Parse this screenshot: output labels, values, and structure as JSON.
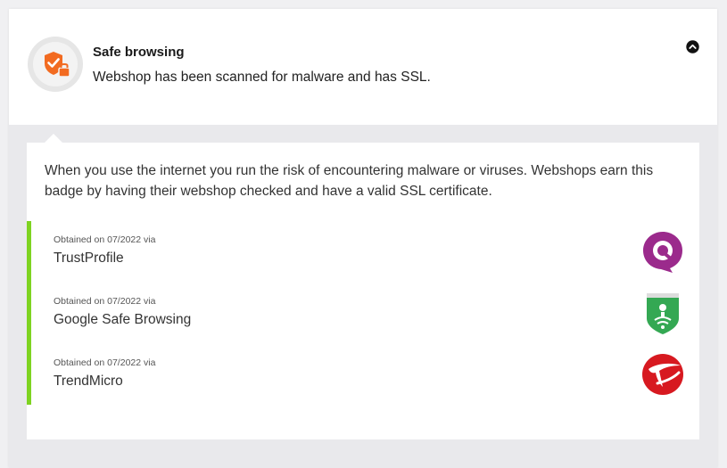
{
  "header": {
    "title": "Safe browsing",
    "subtitle": "Webshop has been scanned for malware and has SSL.",
    "badge_icon": "shield-check-lock-icon",
    "collapse_icon": "chevron-up-circle-icon"
  },
  "panel": {
    "description": "When you use the internet you run the risk of encountering malware or viruses. Webshops earn this badge by having their webshop checked and have a valid SSL certificate.",
    "sources": [
      {
        "obtained": "Obtained on 07/2022 via",
        "name": "TrustProfile",
        "logo": "trustprofile-logo"
      },
      {
        "obtained": "Obtained on 07/2022 via",
        "name": "Google Safe Browsing",
        "logo": "google-safe-browsing-logo"
      },
      {
        "obtained": "Obtained on 07/2022 via",
        "name": "TrendMicro",
        "logo": "trendmicro-logo"
      }
    ]
  },
  "colors": {
    "accent_orange": "#f26b21",
    "verified_green": "#7ed321",
    "trustprofile_purple": "#9b2a8c",
    "google_green": "#34a853",
    "trendmicro_red": "#d71920"
  }
}
